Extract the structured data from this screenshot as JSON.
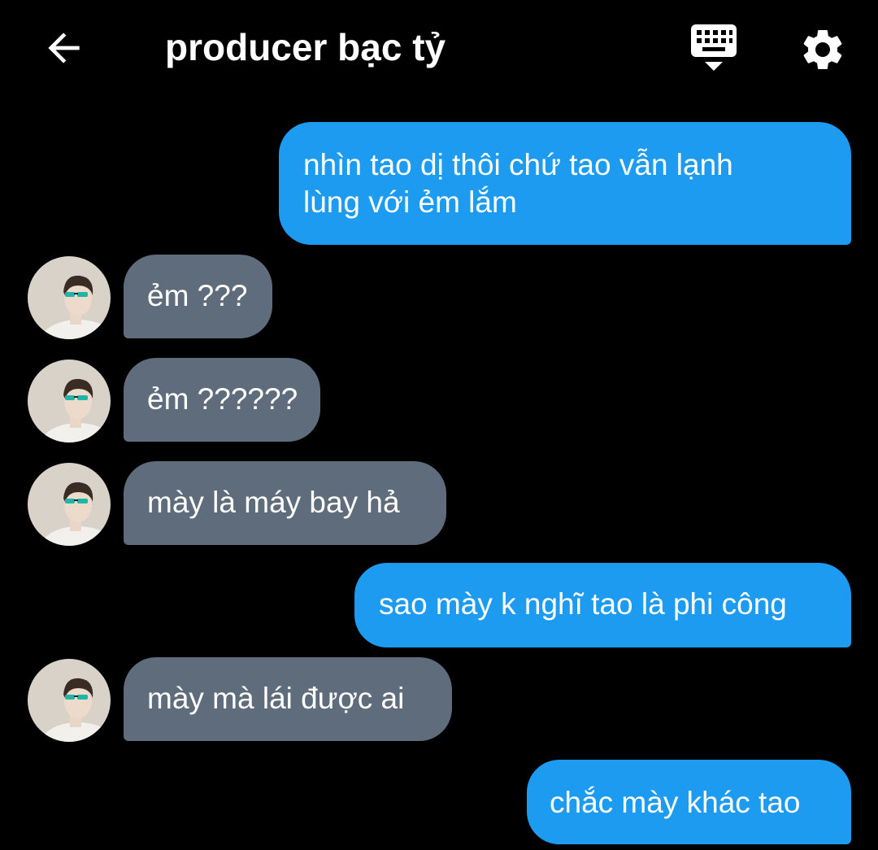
{
  "header": {
    "title": "producer bạc tỷ",
    "back_icon": "arrow-left-icon",
    "keyboard_icon": "keyboard-hide-icon",
    "settings_icon": "gear-icon"
  },
  "colors": {
    "background": "#000000",
    "sent_bubble": "#1d9bf0",
    "received_bubble": "#5f6c7b",
    "text": "#ffffff"
  },
  "messages": [
    {
      "sender": "me",
      "text_lines": [
        "nhìn tao dị thôi chứ tao vẫn lạnh",
        "lùng với ẻm lắm"
      ]
    },
    {
      "sender": "other",
      "text": "ẻm ???"
    },
    {
      "sender": "other",
      "text": "ẻm ??????"
    },
    {
      "sender": "other",
      "text": "mày là máy bay hả"
    },
    {
      "sender": "me",
      "text": "sao mày k nghĩ tao là phi công"
    },
    {
      "sender": "other",
      "text": "mày mà lái được ai"
    },
    {
      "sender": "me",
      "text": "chắc mày khác tao"
    }
  ]
}
